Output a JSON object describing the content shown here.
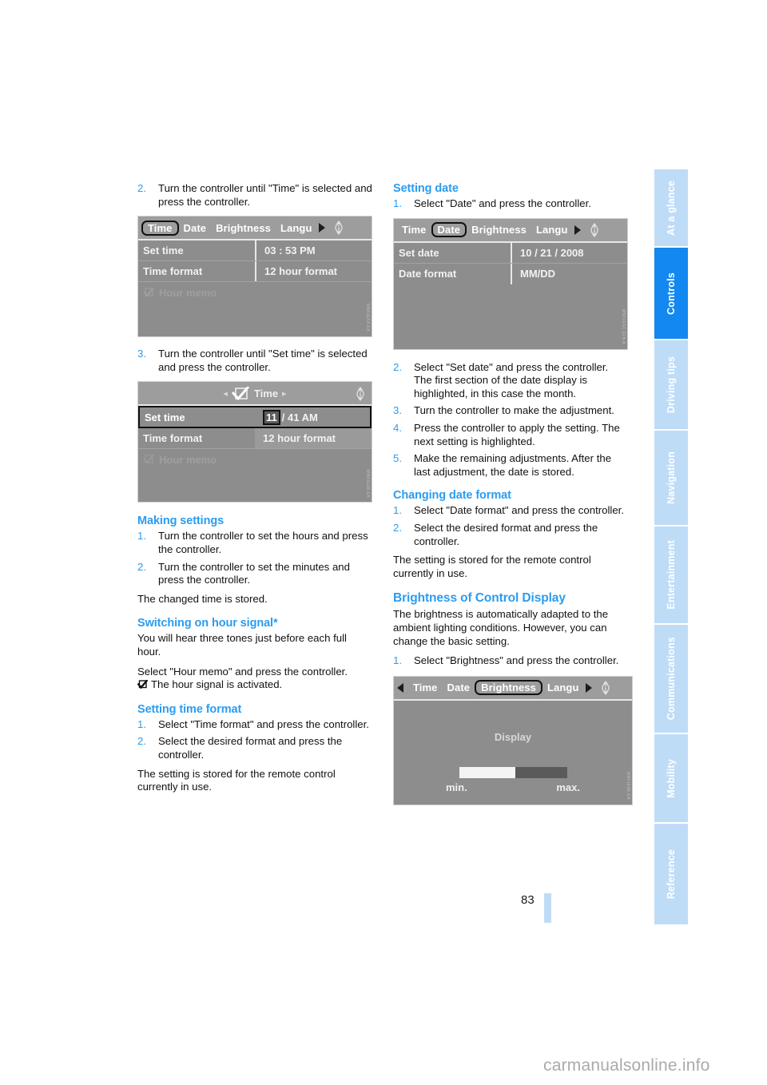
{
  "page": {
    "number": "83",
    "watermark": "carmanualsonline.info"
  },
  "sidebar": {
    "tabs": [
      {
        "label": "At a glance",
        "active": false
      },
      {
        "label": "Controls",
        "active": true
      },
      {
        "label": "Driving tips",
        "active": false
      },
      {
        "label": "Navigation",
        "active": false
      },
      {
        "label": "Entertainment",
        "active": false
      },
      {
        "label": "Communications",
        "active": false
      },
      {
        "label": "Mobility",
        "active": false
      },
      {
        "label": "Reference",
        "active": false
      }
    ],
    "active_color": "#1288f0",
    "inactive_color": "#bfdcf7"
  },
  "left_column": {
    "step2": {
      "num": "2.",
      "text": "Turn the controller until \"Time\" is selected and press the controller."
    },
    "step3": {
      "num": "3.",
      "text": "Turn the controller until \"Set time\" is selected and press the controller."
    },
    "making_settings": {
      "heading": "Making settings",
      "steps": [
        {
          "num": "1.",
          "text": "Turn the controller to set the hours and press the controller."
        },
        {
          "num": "2.",
          "text": "Turn the controller to set the minutes and press the controller."
        }
      ],
      "note": "The changed time is stored."
    },
    "hour_signal": {
      "heading": "Switching on hour signal*",
      "para1": "You will hear three tones just before each full hour.",
      "para2": "Select \"Hour memo\" and press the controller.",
      "para3": "The hour signal is activated."
    },
    "time_format": {
      "heading": "Setting time format",
      "steps": [
        {
          "num": "1.",
          "text": "Select \"Time format\" and press the controller."
        },
        {
          "num": "2.",
          "text": "Select the desired format and press the controller."
        }
      ],
      "note": "The setting is stored for the remote control currently in use."
    }
  },
  "right_column": {
    "setting_date": {
      "heading": "Setting date",
      "steps": [
        {
          "num": "1.",
          "text": "Select \"Date\" and press the controller."
        },
        {
          "num": "2.",
          "text": "Select \"Set date\" and press the controller. The first section of the date display is highlighted, in this case the month."
        },
        {
          "num": "3.",
          "text": "Turn the controller to make the adjustment."
        },
        {
          "num": "4.",
          "text": "Press the controller to apply the setting. The next setting is highlighted."
        },
        {
          "num": "5.",
          "text": "Make the remaining adjustments. After the last adjustment, the date is stored."
        }
      ]
    },
    "changing_date_format": {
      "heading": "Changing date format",
      "steps": [
        {
          "num": "1.",
          "text": "Select \"Date format\" and press the controller."
        },
        {
          "num": "2.",
          "text": "Select the desired format and press the controller."
        }
      ],
      "note": "The setting is stored for the remote control currently in use."
    },
    "brightness": {
      "heading": "Brightness of Control Display",
      "para": "The brightness is automatically adapted to the ambient lighting conditions. However, you can change the basic setting.",
      "steps": [
        {
          "num": "1.",
          "text": "Select \"Brightness\" and press the controller."
        }
      ]
    }
  },
  "figures": {
    "time_menu": {
      "tabs": [
        "Time",
        "Date",
        "Brightness",
        "Langu"
      ],
      "selected_tab": "Time",
      "rows": [
        {
          "label": "Set time",
          "value": "03 : 53 PM"
        },
        {
          "label": "Time format",
          "value": "12 hour format"
        }
      ],
      "checkbox_row": "Hour memo",
      "watermark": "MN01E6A.EA"
    },
    "set_time_edit": {
      "title": "Time",
      "rows": [
        {
          "label": "Set time",
          "value_hl": "11",
          "value_rest": "/ 41 AM",
          "selected": true
        },
        {
          "label": "Time format",
          "value": "12 hour format",
          "selected": false
        }
      ],
      "checkbox_row": "Hour memo",
      "watermark": "MN01E6B.EA"
    },
    "date_menu": {
      "tabs": [
        "Time",
        "Date",
        "Brightness",
        "Langu"
      ],
      "selected_tab": "Date",
      "rows": [
        {
          "label": "Set date",
          "value": "10 / 21 / 2008"
        },
        {
          "label": "Date format",
          "value": "MM/DD"
        }
      ],
      "watermark": "MN01E6C.ELB.A"
    },
    "brightness_menu": {
      "tabs": [
        "Time",
        "Date",
        "Brightness",
        "Langu"
      ],
      "selected_tab": "Brightness",
      "display_label": "Display",
      "min_label": "min.",
      "max_label": "max.",
      "slider_percent": 52,
      "watermark": "MN01E6E.EA"
    }
  }
}
